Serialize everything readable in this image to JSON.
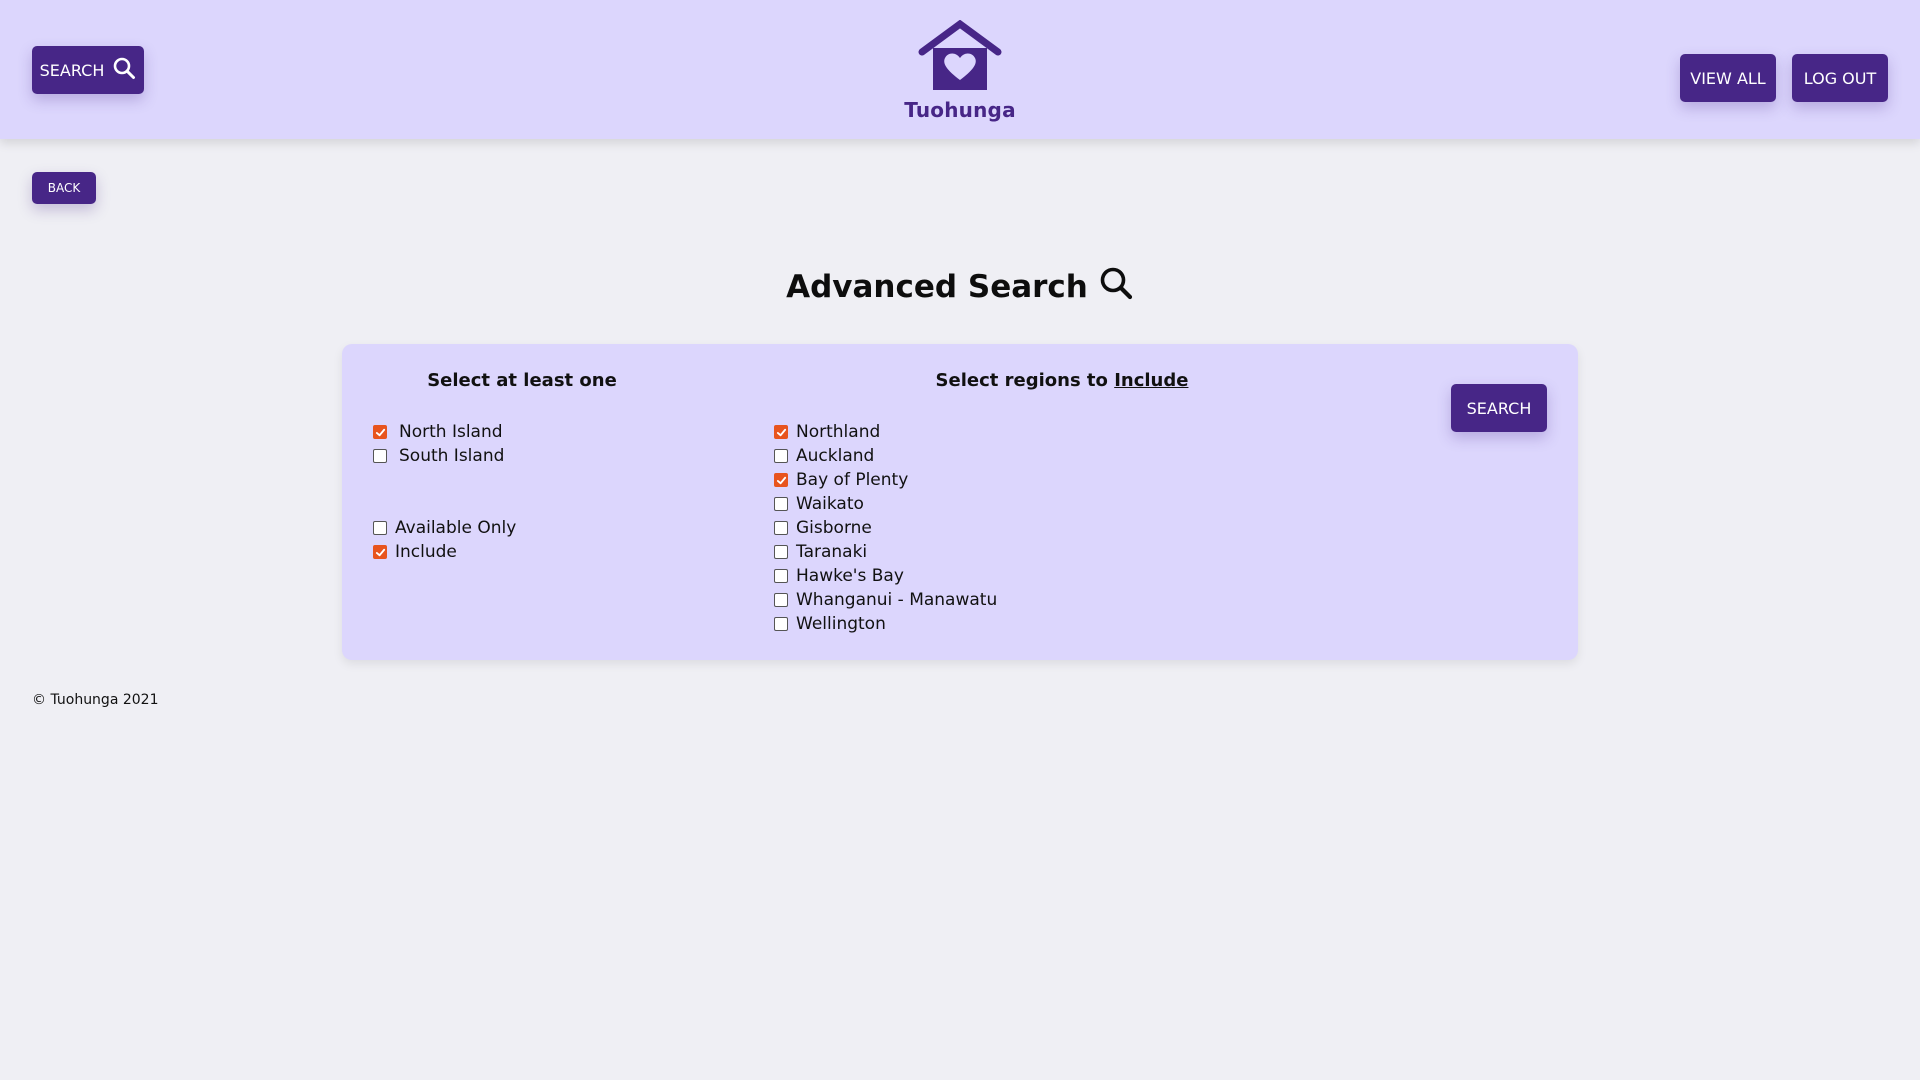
{
  "header": {
    "search_label": "SEARCH",
    "brand": "Tuohunga",
    "view_all_label": "VIEW ALL",
    "log_out_label": "LOG OUT"
  },
  "back_label": "BACK",
  "page_title": "Advanced Search",
  "panel": {
    "left_heading": "Select at least one",
    "right_heading_prefix": "Select regions to",
    "right_heading_emphasis": "Include",
    "search_label": "SEARCH",
    "islands": [
      {
        "label": "North Island",
        "checked": true
      },
      {
        "label": "South Island",
        "checked": false
      }
    ],
    "options": [
      {
        "label": "Available Only",
        "checked": false
      },
      {
        "label": "Include",
        "checked": true
      }
    ],
    "regions": [
      {
        "label": "Northland",
        "checked": true
      },
      {
        "label": "Auckland",
        "checked": false
      },
      {
        "label": "Bay of Plenty",
        "checked": true
      },
      {
        "label": "Waikato",
        "checked": false
      },
      {
        "label": "Gisborne",
        "checked": false
      },
      {
        "label": "Taranaki",
        "checked": false
      },
      {
        "label": "Hawke's Bay",
        "checked": false
      },
      {
        "label": "Whanganui - Manawatu",
        "checked": false
      },
      {
        "label": "Wellington",
        "checked": false
      }
    ]
  },
  "footer": "© Tuohunga 2021",
  "colors": {
    "brand": "#472687",
    "header_bg": "#dcd6fd",
    "page_bg": "#efeff4",
    "checkbox_checked": "#e8541e"
  },
  "icons": {
    "search": "search-icon",
    "logo": "house-heart-icon",
    "check": "check-icon"
  }
}
